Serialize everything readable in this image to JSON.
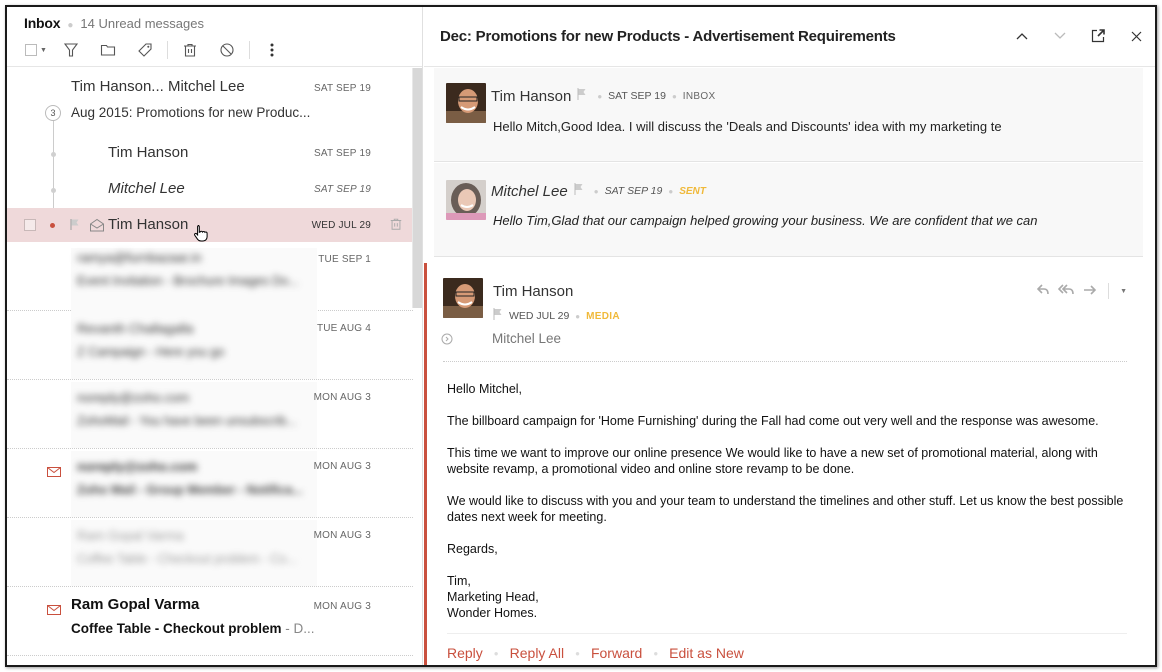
{
  "left": {
    "folder": "Inbox",
    "unread": "14 Unread messages",
    "toolbar": {
      "icons": [
        "checkbox-select",
        "filter-icon",
        "folder-icon",
        "tag-icon",
        "trash-icon",
        "block-icon",
        "more-icon"
      ]
    },
    "thread": {
      "participants": "Tim Hanson... Mitchel Lee",
      "date": "SAT SEP 19",
      "count": "3",
      "subject": "Aug 2015: Promotions for new Produc...",
      "children": [
        {
          "from": "Tim Hanson",
          "date": "SAT SEP 19",
          "italic": false
        },
        {
          "from": "Mitchel Lee",
          "date": "SAT SEP 19",
          "italic": true
        },
        {
          "from": "Tim Hanson",
          "date": "WED JUL 29",
          "selected": true
        }
      ]
    },
    "messages": [
      {
        "from": "ramya@furnbazaar.in",
        "subject": "Event Invitation - Brochure Images Do...",
        "date": "TUE SEP 1",
        "blurred": true,
        "unread": false
      },
      {
        "from": "Revanth Challagalla",
        "subject": "Z Campaign - Here you go",
        "date": "TUE AUG 4",
        "blurred": true,
        "unread": false
      },
      {
        "from": "noreply@zoho.com",
        "subject": "ZohoMail - You have been unsubscrib...",
        "date": "MON AUG 3",
        "blurred": true,
        "unread": false
      },
      {
        "from": "noreply@zoho.com",
        "subject": "Zoho Mail - Group Member - Notifica...",
        "date": "MON AUG 3",
        "blurred": true,
        "unread": true
      },
      {
        "from": "Ram Gopal Varma",
        "subject": "Coffee Table - Checkout problem - Co...",
        "date": "MON AUG 3",
        "blurred": true,
        "unread": false
      },
      {
        "from": "Ram Gopal Varma",
        "subject": "Coffee Table - Checkout problem",
        "subject_preview": " - D...",
        "date": "MON AUG 3",
        "blurred": false,
        "unread": true
      }
    ]
  },
  "right": {
    "title": "Dec: Promotions for new Products - Advertisement Requirements",
    "collapsed": [
      {
        "name": "Tim Hanson",
        "date": "SAT SEP 19",
        "folder": "INBOX",
        "snippet": "Hello Mitch,Good Idea. I will discuss the 'Deals and Discounts' idea with my marketing te"
      },
      {
        "name": "Mitchel Lee",
        "date": "SAT SEP 19",
        "folder": "SENT",
        "snippet": "Hello Tim,Glad that our campaign helped growing your business. We are confident that we can"
      }
    ],
    "expanded": {
      "name": "Tim Hanson",
      "date": "WED JUL 29",
      "tag": "MEDIA",
      "to": "Mitchel Lee",
      "body": {
        "greeting": "Hello Mitchel,",
        "p1": "The billboard campaign for 'Home Furnishing' during the Fall had come out very well and the response was awesome.",
        "p2": "This time we want to improve our online presence We would like to have a new set of promotional material, along with website revamp, a promotional video and online store revamp to be done.",
        "p3": "We would like to discuss with you and your team to understand the timelines and other stuff. Let us know the best possible dates next week for meeting.",
        "closing": "Regards,",
        "sig1": "Tim,",
        "sig2": "Marketing Head,",
        "sig3": "Wonder Homes."
      },
      "actions": {
        "reply": "Reply",
        "reply_all": "Reply All",
        "forward": "Forward",
        "edit_as_new": "Edit as New"
      }
    }
  },
  "colors": {
    "accent": "#c9503e",
    "selected_row": "#efd9da",
    "tag": "#f0b93a"
  }
}
